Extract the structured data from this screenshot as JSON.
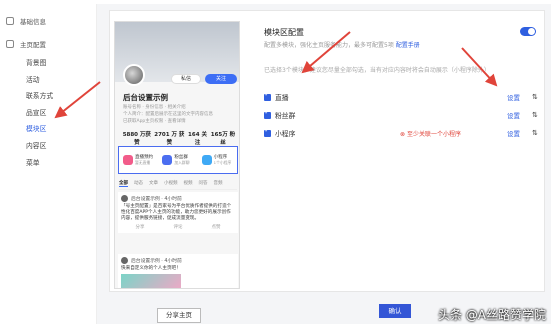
{
  "sidebar": {
    "sections": [
      {
        "label": "基础信息"
      },
      {
        "label": "主页配置"
      }
    ],
    "items": [
      {
        "label": "背景图"
      },
      {
        "label": "活动"
      },
      {
        "label": "联系方式"
      },
      {
        "label": "品宣区"
      },
      {
        "label": "模块区",
        "active": true
      },
      {
        "label": "内容区"
      },
      {
        "label": "菜单"
      }
    ]
  },
  "preview": {
    "message_btn": "私信",
    "follow_btn": "关注",
    "name": "后台设置示例",
    "sub1": "账号名称 · 身份信息 · 相关介绍",
    "sub2": "个人简介：配置后展示在这里的文字内容信息",
    "sub3": "已获取App主页权限 · 查看详情",
    "stats": [
      {
        "value": "5880 万获赞",
        "label": ""
      },
      {
        "value": "2701 万 获赞",
        "label": ""
      },
      {
        "value": "164 关注",
        "label": ""
      },
      {
        "value": "165万 粉丝",
        "label": ""
      }
    ],
    "modules": [
      {
        "title": "直播预约",
        "sub": "暂无直播",
        "color": "#f25c8a"
      },
      {
        "title": "粉丝群",
        "sub": "加入群聊",
        "color": "#4b6ef0"
      },
      {
        "title": "小程序",
        "sub": "1个小程序",
        "color": "#3fa9f5"
      }
    ],
    "tabs": [
      "全部",
      "动态",
      "文章",
      "小视频",
      "视频",
      "问答",
      "音频"
    ],
    "feed1": {
      "author": "后台设置示例 · 4小时前",
      "text": "「号主页配置」是百家号为平台优质作者提供的打造个性化百度APP个人主页的功能，助力您更好的展示创作内容，提供服务链接，促成流量变现。",
      "actions": [
        "分享",
        "评论",
        "点赞"
      ]
    },
    "feed2": {
      "author": "后台设置示例 · 4小时前",
      "text": "快来自定义你的个人主页吧！"
    }
  },
  "settings": {
    "title": "模块区配置",
    "desc": "配置多模块，强化主页服务能力，最多可配置5项",
    "desc_link": "配置手册",
    "hint": "已选择3个模块，建议您尽量全部勾选，当有对应内容时将会自动展示（小程序除外）",
    "rows": [
      {
        "label": "直播",
        "set": "设置",
        "warn": ""
      },
      {
        "label": "粉丝群",
        "set": "设置",
        "warn": ""
      },
      {
        "label": "小程序",
        "set": "设置",
        "warn": "至少关联一个小程序"
      }
    ],
    "sort_icon": "sort-icon"
  },
  "footer": {
    "share_btn": "分享主页",
    "confirm_btn": "确认"
  },
  "watermark": "头条 @A丝路赞学院",
  "colors": {
    "accent": "#2f5fe0",
    "arrow": "#e0443a"
  }
}
